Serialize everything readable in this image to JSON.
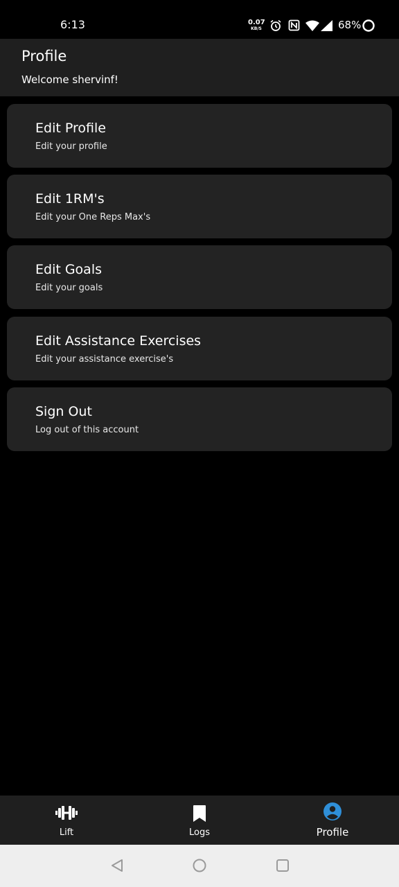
{
  "status_bar": {
    "time": "6:13",
    "net_speed_value": "0.07",
    "net_speed_unit": "KB/S",
    "battery": "68%"
  },
  "header": {
    "title": "Profile",
    "welcome": "Welcome shervinf!"
  },
  "menu": {
    "items": [
      {
        "title": "Edit Profile",
        "subtitle": "Edit your profile"
      },
      {
        "title": "Edit 1RM's",
        "subtitle": "Edit your One Reps Max's"
      },
      {
        "title": "Edit Goals",
        "subtitle": "Edit your goals"
      },
      {
        "title": "Edit Assistance Exercises",
        "subtitle": "Edit your assistance exercise's"
      },
      {
        "title": "Sign Out",
        "subtitle": "Log out of this account"
      }
    ]
  },
  "bottom_nav": {
    "items": [
      {
        "label": "Lift",
        "icon": "dumbbell-icon"
      },
      {
        "label": "Logs",
        "icon": "bookmark-icon"
      },
      {
        "label": "Profile",
        "icon": "account-circle-icon"
      }
    ],
    "active_color": "#2f8fd8"
  },
  "colors": {
    "background": "#000000",
    "surface": "#1f1f1f",
    "card": "#232323",
    "accent": "#2f8fd8"
  }
}
